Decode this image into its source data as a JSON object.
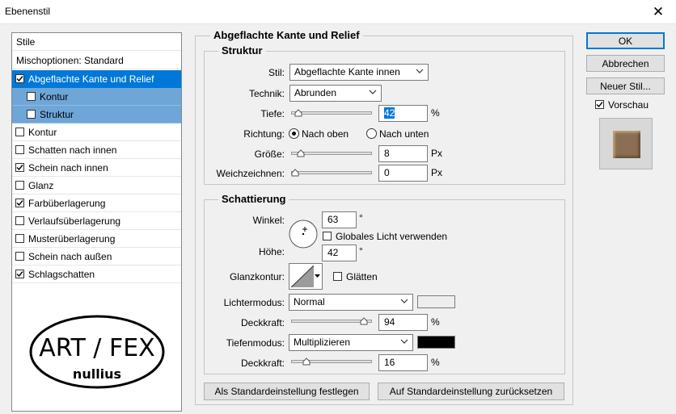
{
  "window": {
    "title": "Ebenenstil",
    "close_icon": "close-icon"
  },
  "styles_panel": {
    "header": "Stile",
    "blending": "Mischoptionen: Standard",
    "items": [
      {
        "label": "Abgeflachte Kante und Relief",
        "checked": true,
        "selected": true
      },
      {
        "label": "Kontur",
        "checked": false,
        "sub": true
      },
      {
        "label": "Struktur",
        "checked": false,
        "sub": true
      },
      {
        "label": "Kontur",
        "checked": false
      },
      {
        "label": "Schatten nach innen",
        "checked": false
      },
      {
        "label": "Schein nach innen",
        "checked": true
      },
      {
        "label": "Glanz",
        "checked": false
      },
      {
        "label": "Farbüberlagerung",
        "checked": true
      },
      {
        "label": "Verlaufsüberlagerung",
        "checked": false
      },
      {
        "label": "Musterüberlagerung",
        "checked": false
      },
      {
        "label": "Schein nach außen",
        "checked": false
      },
      {
        "label": "Schlagschatten",
        "checked": true
      }
    ],
    "logo": {
      "line1": "ART / FEX",
      "line2": "nullius"
    }
  },
  "main": {
    "title": "Abgeflachte Kante und Relief",
    "structure": {
      "title": "Struktur",
      "stil_label": "Stil:",
      "stil_value": "Abgeflachte Kante innen",
      "technik_label": "Technik:",
      "technik_value": "Abrunden",
      "tiefe_label": "Tiefe:",
      "tiefe_value": "42",
      "tiefe_unit": "%",
      "tiefe_slider_frac": 0.04,
      "richtung_label": "Richtung:",
      "richtung_up": "Nach oben",
      "richtung_down": "Nach unten",
      "richtung_selected": "up",
      "groesse_label": "Größe:",
      "groesse_value": "8",
      "groesse_unit": "Px",
      "groesse_slider_frac": 0.08,
      "weich_label": "Weichzeichnen:",
      "weich_value": "0",
      "weich_unit": "Px",
      "weich_slider_frac": 0.0
    },
    "shading": {
      "title": "Schattierung",
      "winkel_label": "Winkel:",
      "winkel_value": "63",
      "winkel_unit": "°",
      "global_light_label": "Globales Licht verwenden",
      "global_light_checked": false,
      "hoehe_label": "Höhe:",
      "hoehe_value": "42",
      "hoehe_unit": "°",
      "gloss_label": "Glanzkontur:",
      "smooth_label": "Glätten",
      "smooth_checked": false,
      "highlight_mode_label": "Lichtermodus:",
      "highlight_mode_value": "Normal",
      "highlight_color": "#eeeeee",
      "highlight_opacity_label": "Deckkraft:",
      "highlight_opacity_value": "94",
      "highlight_opacity_unit": "%",
      "highlight_slider_frac": 0.94,
      "shadow_mode_label": "Tiefenmodus:",
      "shadow_mode_value": "Multiplizieren",
      "shadow_color": "#000000",
      "shadow_opacity_label": "Deckkraft:",
      "shadow_opacity_value": "16",
      "shadow_opacity_unit": "%",
      "shadow_slider_frac": 0.16
    },
    "make_default_label": "Als Standardeinstellung festlegen",
    "reset_default_label": "Auf Standardeinstellung zurücksetzen"
  },
  "buttons": {
    "ok": "OK",
    "cancel": "Abbrechen",
    "new_style": "Neuer Stil...",
    "preview_label": "Vorschau",
    "preview_checked": true
  }
}
